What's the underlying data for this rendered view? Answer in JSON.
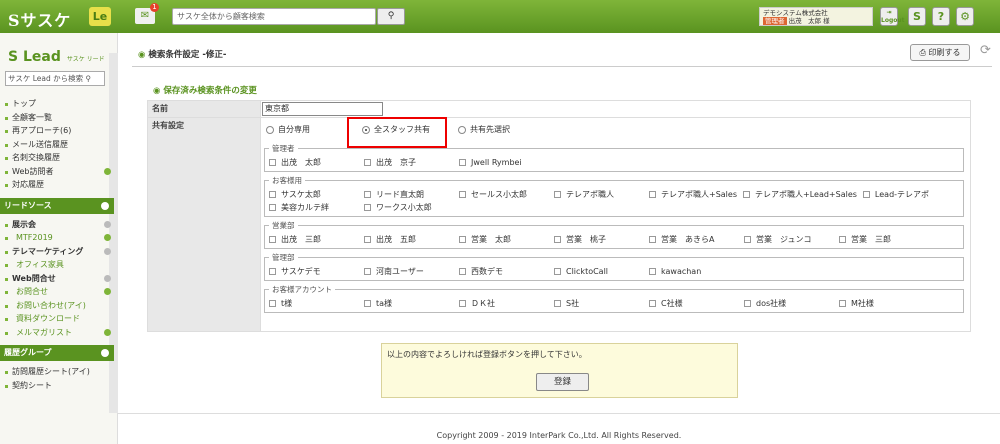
{
  "header": {
    "logo": "Sサスケ",
    "app_badge": "Le",
    "notification_count": "1",
    "search_placeholder": "サスケ全体から顧客検索",
    "company": "デモシステム株式会社",
    "role_tag": "管理者",
    "user_name": "出茂　太郎 様",
    "logout_label": "Logout",
    "help_label": "?"
  },
  "sidebar": {
    "logo": "Lead",
    "logo_sub": "サスケ リード",
    "search_placeholder": "サスケ Lead から検索",
    "items": [
      {
        "label": "トップ"
      },
      {
        "label": "全顧客一覧"
      },
      {
        "label": "再アプローチ(6)"
      },
      {
        "label": "メール送信履歴"
      },
      {
        "label": "名刺交換履歴"
      },
      {
        "label": "Web訪問者"
      },
      {
        "label": "対応履歴"
      }
    ],
    "section1": "リードソース",
    "lead_sources": [
      {
        "label": "展示会",
        "head": true
      },
      {
        "label": "MTF2019",
        "head": false
      },
      {
        "label": "テレマーケティング",
        "head": true
      },
      {
        "label": "オフィス家具",
        "head": false
      },
      {
        "label": "Web問合せ",
        "head": true
      },
      {
        "label": "お問合せ",
        "head": false
      },
      {
        "label": "お問い合わせ(アイ)",
        "head": false
      },
      {
        "label": "資料ダウンロード",
        "head": false
      },
      {
        "label": "メルマガリスト",
        "head": false
      }
    ],
    "section2": "履歴グループ",
    "history_groups": [
      {
        "label": "訪問履歴シート(アイ)"
      },
      {
        "label": "契約シート"
      }
    ]
  },
  "page": {
    "title": "検索条件設定 -修正-",
    "print_label": "印刷する",
    "subtitle": "保存済み検索条件の変更",
    "name_label": "名前",
    "name_value": "東京都",
    "share_label": "共有設定",
    "radios": [
      {
        "label": "自分専用",
        "checked": false
      },
      {
        "label": "全スタッフ共有",
        "checked": true
      },
      {
        "label": "共有先選択",
        "checked": false
      }
    ],
    "groups": [
      {
        "name": "管理者",
        "members": [
          "出茂　太郎",
          "出茂　京子",
          "Jwell Rymbei"
        ]
      },
      {
        "name": "お客様用",
        "members": [
          "サスケ太郎",
          "リード直太朗",
          "セールス小太郎",
          "テレアポ職人",
          "テレアポ職人+Sales",
          "テレアポ職人+Lead+Sales",
          "Lead-テレアポ",
          "美容カルテ絆",
          "ワークス小太郎"
        ]
      },
      {
        "name": "営業部",
        "members": [
          "出茂　三郎",
          "出茂　五郎",
          "営業　太郎",
          "営業　桃子",
          "営業　あきらA",
          "営業　ジュンコ",
          "営業　三郎"
        ]
      },
      {
        "name": "管理部",
        "members": [
          "サスケデモ",
          "河南ユーザー",
          "西数デモ",
          "ClicktoCall",
          "kawachan"
        ]
      },
      {
        "name": "お客様アカウント",
        "members": [
          "t様",
          "ta様",
          "ＤＫ社",
          "S社",
          "C社様",
          "dos社様",
          "M社様"
        ]
      }
    ],
    "confirm_text": "以上の内容でよろしければ登録ボタンを押して下さい。",
    "register_label": "登録",
    "copyright": "Copyright 2009 - 2019 InterPark Co.,Ltd. All Rights Reserved."
  }
}
